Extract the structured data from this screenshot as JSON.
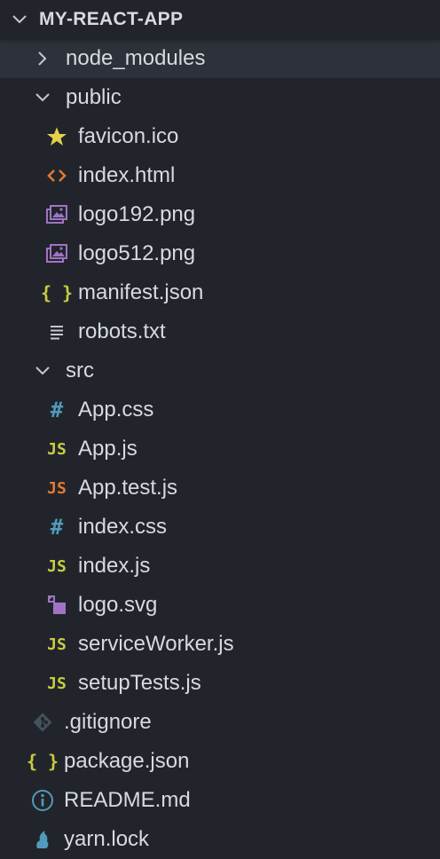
{
  "root": {
    "title": "MY-REACT-APP"
  },
  "colors": {
    "background": "#21252b",
    "selected_row": "#2c313a",
    "text": "#d7dae0",
    "star": "#e5d04c",
    "html": "#e37933",
    "image": "#a074c4",
    "json": "#cbcb41",
    "css": "#519aba",
    "js": "#cbcb41",
    "test": "#e37933",
    "git": "#41535b",
    "info": "#519aba",
    "yarn": "#519aba"
  },
  "tree": {
    "node_modules": {
      "label": "node_modules",
      "icon": "chevron-right-icon"
    },
    "public": {
      "label": "public",
      "icon": "chevron-down-icon",
      "children": {
        "favicon": {
          "label": "favicon.ico",
          "icon": "star-icon"
        },
        "index_html": {
          "label": "index.html",
          "icon": "html-icon"
        },
        "logo192": {
          "label": "logo192.png",
          "icon": "image-icon"
        },
        "logo512": {
          "label": "logo512.png",
          "icon": "image-icon"
        },
        "manifest": {
          "label": "manifest.json",
          "icon": "json-icon"
        },
        "robots": {
          "label": "robots.txt",
          "icon": "text-file-icon"
        }
      }
    },
    "src": {
      "label": "src",
      "icon": "chevron-down-icon",
      "children": {
        "app_css": {
          "label": "App.css",
          "icon": "css-icon"
        },
        "app_js": {
          "label": "App.js",
          "icon": "js-icon"
        },
        "app_test": {
          "label": "App.test.js",
          "icon": "js-test-icon"
        },
        "index_css": {
          "label": "index.css",
          "icon": "css-icon"
        },
        "index_js": {
          "label": "index.js",
          "icon": "js-icon"
        },
        "logo_svg": {
          "label": "logo.svg",
          "icon": "svg-icon"
        },
        "service_worker": {
          "label": "serviceWorker.js",
          "icon": "js-icon"
        },
        "setup_tests": {
          "label": "setupTests.js",
          "icon": "js-icon"
        }
      }
    },
    "gitignore": {
      "label": ".gitignore",
      "icon": "git-icon"
    },
    "package_json": {
      "label": "package.json",
      "icon": "json-icon"
    },
    "readme": {
      "label": "README.md",
      "icon": "info-icon"
    },
    "yarn_lock": {
      "label": "yarn.lock",
      "icon": "yarn-icon"
    }
  },
  "icon_glyphs": {
    "json": "{ }",
    "js": "JS",
    "css": "#"
  }
}
